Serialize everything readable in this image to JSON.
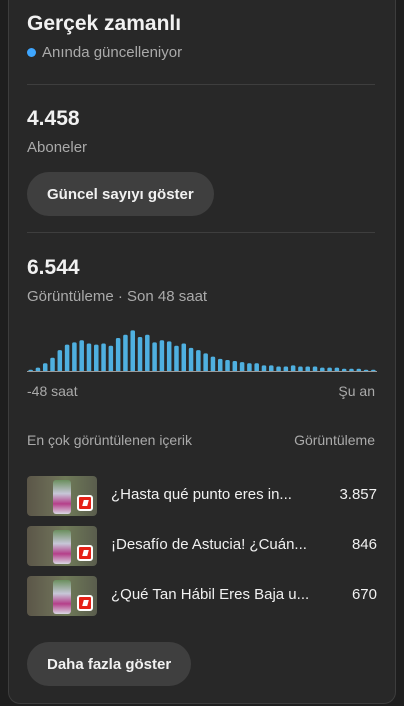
{
  "header": {
    "title": "Gerçek zamanlı",
    "live_label": "Anında güncelleniyor"
  },
  "subscribers": {
    "value": "4.458",
    "label": "Aboneler",
    "button_label": "Güncel sayıyı göster"
  },
  "views": {
    "value": "6.544",
    "label": "Görüntüleme · Son 48 saat",
    "axis_start": "-48 saat",
    "axis_end": "Şu an"
  },
  "top_content": {
    "header_left": "En çok görüntülenen içerik",
    "header_right": "Görüntüleme",
    "items": [
      {
        "title": "¿Hasta qué punto eres in...",
        "views": "3.857"
      },
      {
        "title": "¡Desafío de Astucia! ¿Cuán...",
        "views": "846"
      },
      {
        "title": "¿Qué Tan Hábil Eres Baja u...",
        "views": "670"
      }
    ],
    "more_button": "Daha fazla göster"
  },
  "colors": {
    "accent": "#3ea6ff",
    "bar": "#4fb0e0",
    "card": "#282828"
  },
  "chart_data": {
    "type": "bar",
    "x_range_hours": [
      -48,
      0
    ],
    "values": [
      2,
      4,
      8,
      13,
      20,
      25,
      27,
      29,
      26,
      25,
      26,
      24,
      31,
      34,
      38,
      32,
      34,
      27,
      29,
      28,
      24,
      26,
      22,
      20,
      17,
      14,
      12,
      11,
      10,
      9,
      8,
      8,
      6,
      6,
      5,
      5,
      6,
      5,
      5,
      5,
      4,
      4,
      4,
      3,
      3,
      3,
      2,
      2
    ],
    "ymax": 42,
    "xlabel": "",
    "ylabel": ""
  }
}
